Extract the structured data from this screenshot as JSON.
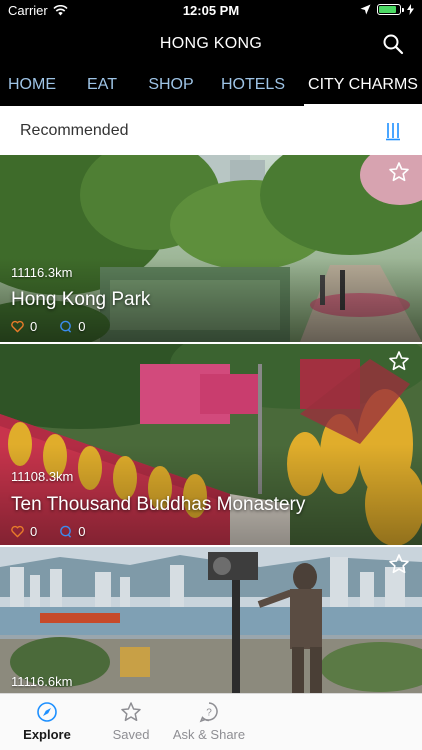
{
  "status_bar": {
    "carrier": "Carrier",
    "time": "12:05 PM",
    "battery_level": 0.85
  },
  "header": {
    "title": "HONG KONG"
  },
  "tabs": [
    {
      "label": "HOME",
      "active": false
    },
    {
      "label": "EAT",
      "active": false
    },
    {
      "label": "SHOP",
      "active": false
    },
    {
      "label": "HOTELS",
      "active": false
    },
    {
      "label": "CITY CHARMS",
      "active": true
    }
  ],
  "section": {
    "label": "Recommended"
  },
  "cards": [
    {
      "distance": "11116.3km",
      "name": "Hong Kong Park",
      "likes": "0",
      "comments": "0"
    },
    {
      "distance": "11108.3km",
      "name": "Ten Thousand Buddhas Monastery",
      "likes": "0",
      "comments": "0"
    },
    {
      "distance": "11116.6km"
    }
  ],
  "bottom_nav": [
    {
      "label": "Explore",
      "icon": "compass-icon",
      "active": true
    },
    {
      "label": "Saved",
      "icon": "star-icon",
      "active": false
    },
    {
      "label": "Ask & Share",
      "icon": "question-bubble-icon",
      "active": false
    }
  ],
  "colors": {
    "accent": "#1e90ff",
    "tab_inactive": "#9ec4e6",
    "heart": "#e87b2a",
    "comment": "#3a8cf0"
  }
}
